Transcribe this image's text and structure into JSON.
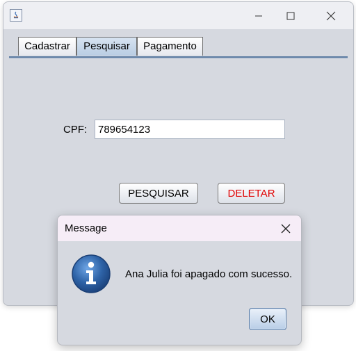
{
  "window": {
    "title": "",
    "icon": "java-icon"
  },
  "tabs": [
    {
      "label": "Cadastrar",
      "active": false
    },
    {
      "label": "Pesquisar",
      "active": true
    },
    {
      "label": "Pagamento",
      "active": false
    }
  ],
  "form": {
    "cpf_label": "CPF:",
    "cpf_value": "789654123"
  },
  "buttons": {
    "search_label": "PESQUISAR",
    "delete_label": "DELETAR",
    "delete_color": "#e00000"
  },
  "dialog": {
    "title": "Message",
    "message": "Ana Julia foi apagado com sucesso.",
    "ok_label": "OK",
    "icon": "info-icon"
  },
  "colors": {
    "background": "#d6d9e0",
    "accent": "#2e63a7"
  }
}
